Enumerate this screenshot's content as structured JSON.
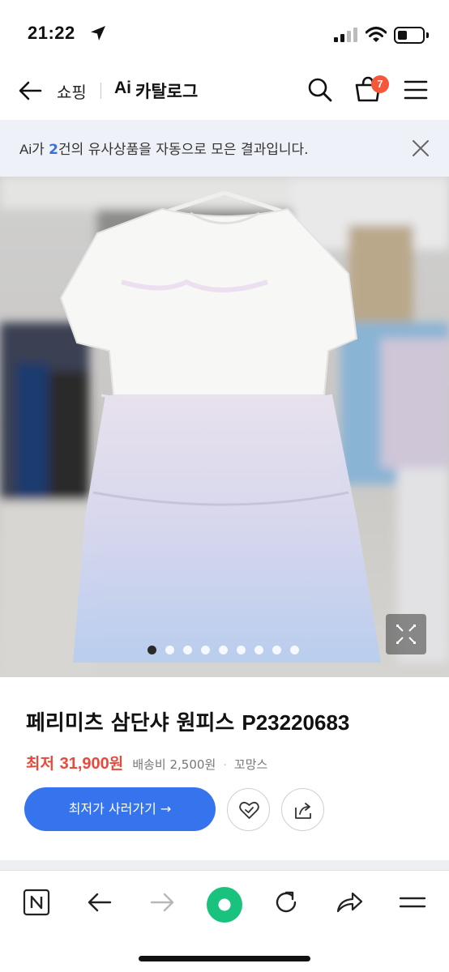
{
  "status_bar": {
    "time": "21:22"
  },
  "header": {
    "shopping_label": "쇼핑",
    "ai_label": "Ai",
    "catalog_label": "카탈로그",
    "cart_count": "7"
  },
  "banner": {
    "ai_prefix": "Ai",
    "text_before_count": "가 ",
    "count": "2",
    "text_after_count": "건의 유사상품을 자동으로 모은 결과입니다."
  },
  "gallery": {
    "total_images": 9,
    "active_index": 0
  },
  "product": {
    "title_ko": "페리미츠 삼단샤 원피스 ",
    "title_code": "P23220683",
    "price_label": "최저 ",
    "price_value": "31,900",
    "price_unit": "원",
    "shipping": "배송비 2,500원",
    "separator": "·",
    "seller": "꼬망스",
    "buy_button_label": "최저가 사러가기 →"
  },
  "colors": {
    "accent_blue": "#3574ec",
    "price_red": "#e8493a",
    "badge_red": "#f5573b",
    "refresh_green": "#19c37d",
    "banner_bg": "#eef2f8"
  },
  "icons": {
    "back": "left-arrow-icon",
    "search": "search-icon",
    "cart": "basket-icon",
    "menu": "hamburger-icon",
    "close": "close-icon",
    "expand": "expand-icon",
    "favorite": "heart-check-icon",
    "share": "share-icon"
  },
  "toolbar": {
    "items": [
      "naver-n-icon",
      "back-arrow-icon",
      "forward-arrow-icon",
      "green-dot-icon",
      "refresh-icon",
      "share-arrow-icon",
      "menu-lines-icon"
    ]
  }
}
